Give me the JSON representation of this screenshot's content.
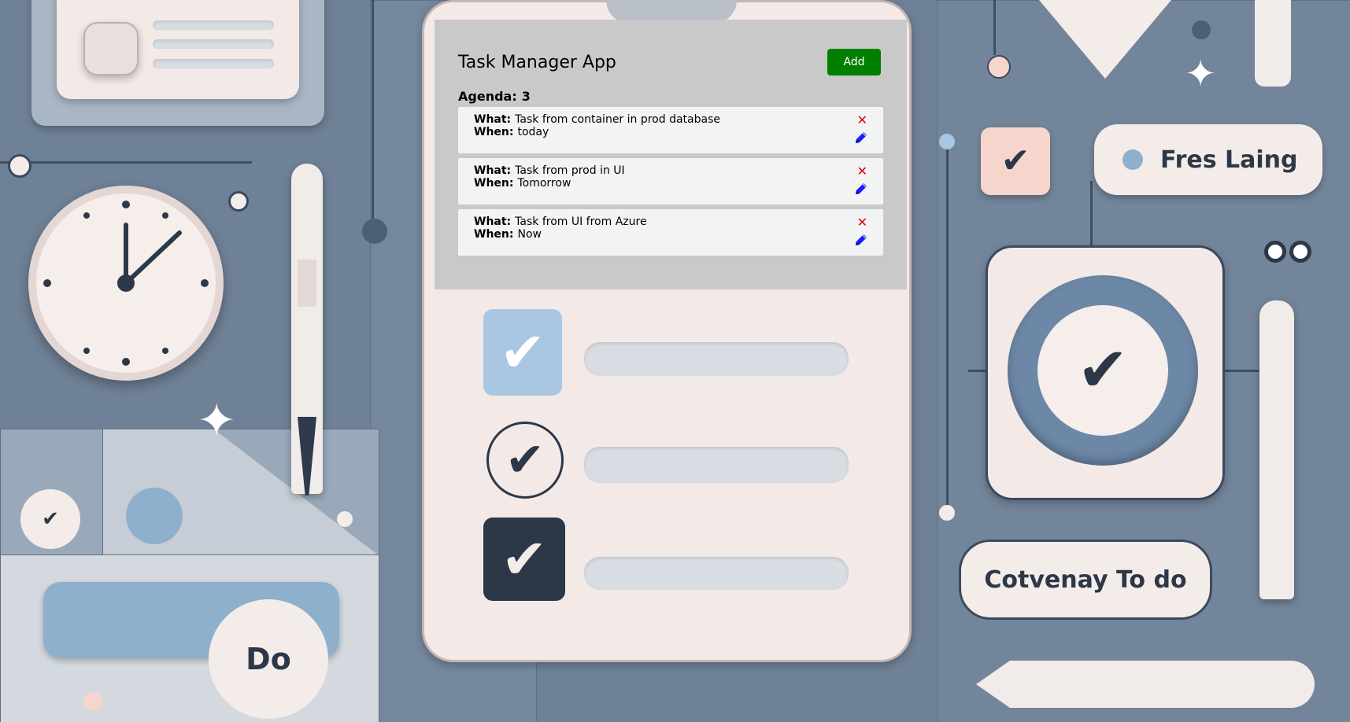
{
  "app": {
    "title": "Task Manager App",
    "add_label": "Add",
    "agenda_label": "Agenda:",
    "agenda_count": "3",
    "what_label": "What:",
    "when_label": "When:",
    "tasks": [
      {
        "what": "Task from container in prod database",
        "when": "today"
      },
      {
        "what": "Task from prod in UI",
        "when": "Tomorrow"
      },
      {
        "what": "Task from UI from Azure",
        "when": "Now"
      }
    ],
    "delete_icon": "close-icon",
    "edit_icon": "pencil-icon",
    "colors": {
      "panel": "#c9c9c9",
      "add_button": "#008000",
      "delete": "#e00000",
      "edit": "#1a1aff"
    }
  },
  "background": {
    "pill_name": "Fres Laing",
    "pill_todo": "Cotvenay To do",
    "pill_do": "Do"
  }
}
